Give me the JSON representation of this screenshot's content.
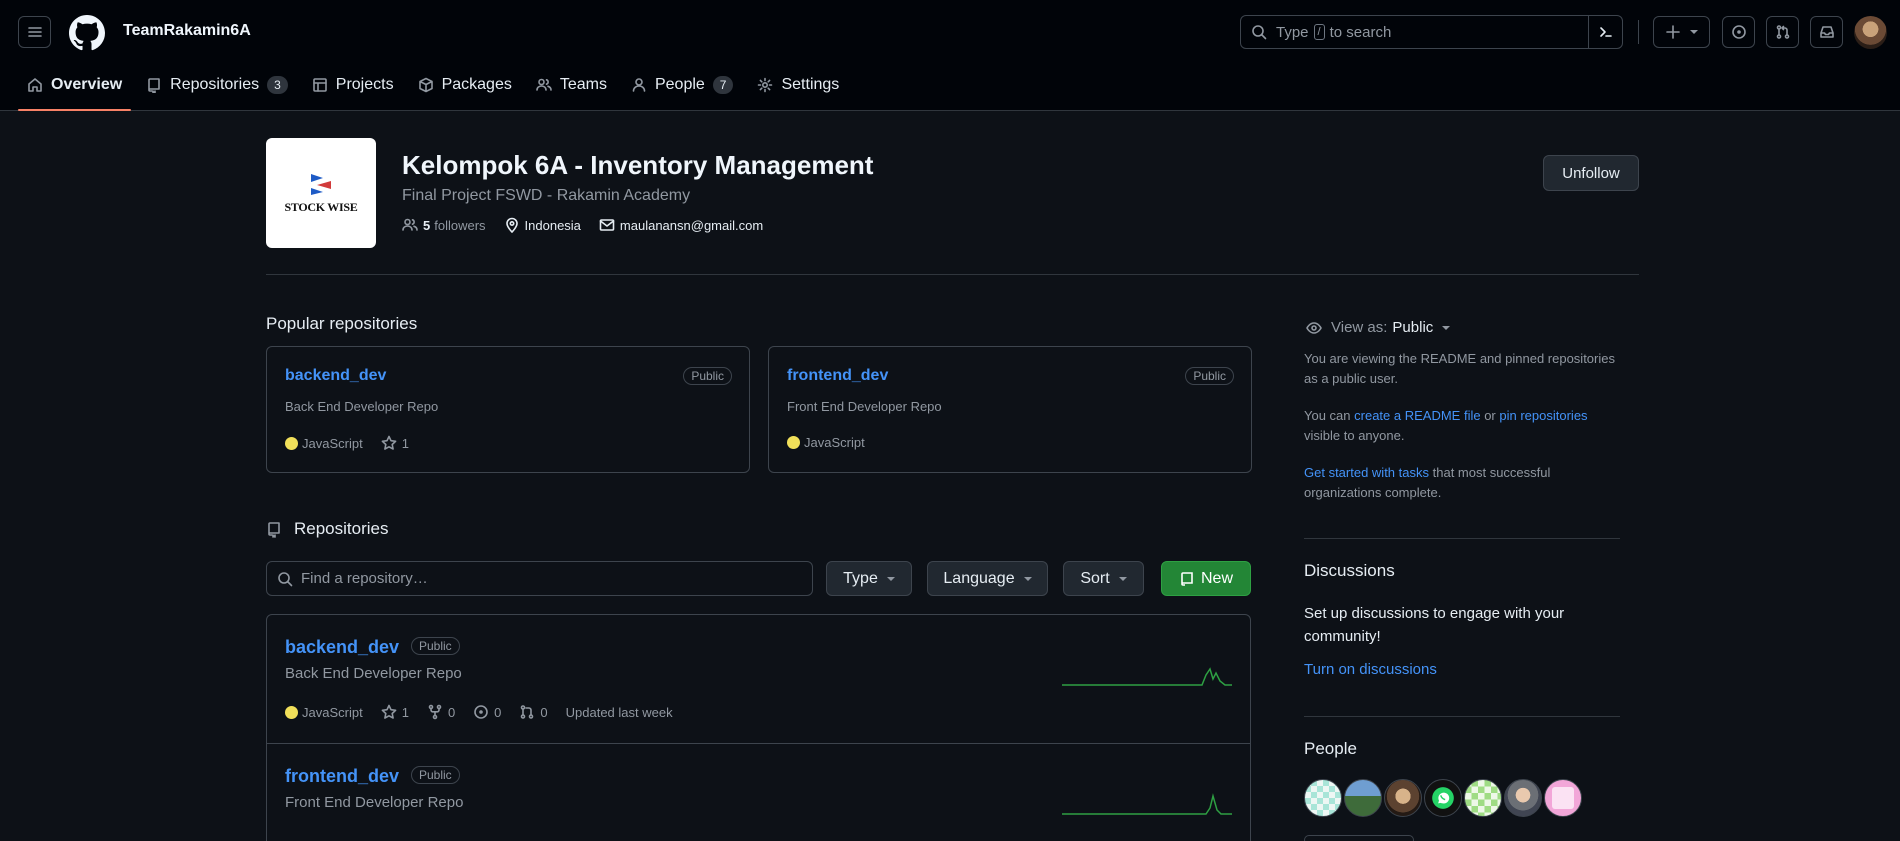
{
  "header": {
    "org_name": "TeamRakamin6A",
    "search_prefix": "Type",
    "search_key": "/",
    "search_suffix": "to search"
  },
  "nav": {
    "overview": "Overview",
    "repositories": "Repositories",
    "repositories_count": "3",
    "projects": "Projects",
    "packages": "Packages",
    "teams": "Teams",
    "people": "People",
    "people_count": "7",
    "settings": "Settings"
  },
  "profile": {
    "avatar_text": "STOCK WISE",
    "title": "Kelompok 6A - Inventory Management",
    "description": "Final Project FSWD - Rakamin Academy",
    "followers_count": "5",
    "followers_label": "followers",
    "location": "Indonesia",
    "email": "maulanansn@gmail.com",
    "unfollow_label": "Unfollow"
  },
  "popular": {
    "title": "Popular repositories",
    "items": [
      {
        "name": "backend_dev",
        "visibility": "Public",
        "description": "Back End Developer Repo",
        "language": "JavaScript",
        "stars": "1"
      },
      {
        "name": "frontend_dev",
        "visibility": "Public",
        "description": "Front End Developer Repo",
        "language": "JavaScript"
      }
    ]
  },
  "repositories": {
    "title": "Repositories",
    "search_placeholder": "Find a repository…",
    "type_label": "Type",
    "language_label": "Language",
    "sort_label": "Sort",
    "new_label": "New",
    "items": [
      {
        "name": "backend_dev",
        "visibility": "Public",
        "description": "Back End Developer Repo",
        "language": "JavaScript",
        "stars": "1",
        "forks": "0",
        "issues": "0",
        "pulls": "0",
        "updated": "Updated last week"
      },
      {
        "name": "frontend_dev",
        "visibility": "Public",
        "description": "Front End Developer Repo"
      }
    ]
  },
  "sidebar": {
    "view_as_label": "View as:",
    "view_as_value": "Public",
    "viewing_text": "You are viewing the README and pinned repositories as a public user.",
    "can_prefix": "You can",
    "create_readme_link": "create a README file",
    "or_text": "or",
    "pin_repos_link": "pin repositories",
    "visible_text": "visible to anyone.",
    "get_started_link": "Get started with tasks",
    "get_started_suffix": "that most successful organizations complete.",
    "discussions_title": "Discussions",
    "discussions_text": "Set up discussions to engage with your community!",
    "turn_on_link": "Turn on discussions",
    "people_title": "People"
  },
  "colors": {
    "background": "#0d1117",
    "header_bg": "#010409",
    "link": "#4493f8",
    "accent_underline": "#f78166",
    "new_button": "#238636",
    "javascript": "#f1e05a",
    "sparkline": "#2ea043"
  }
}
